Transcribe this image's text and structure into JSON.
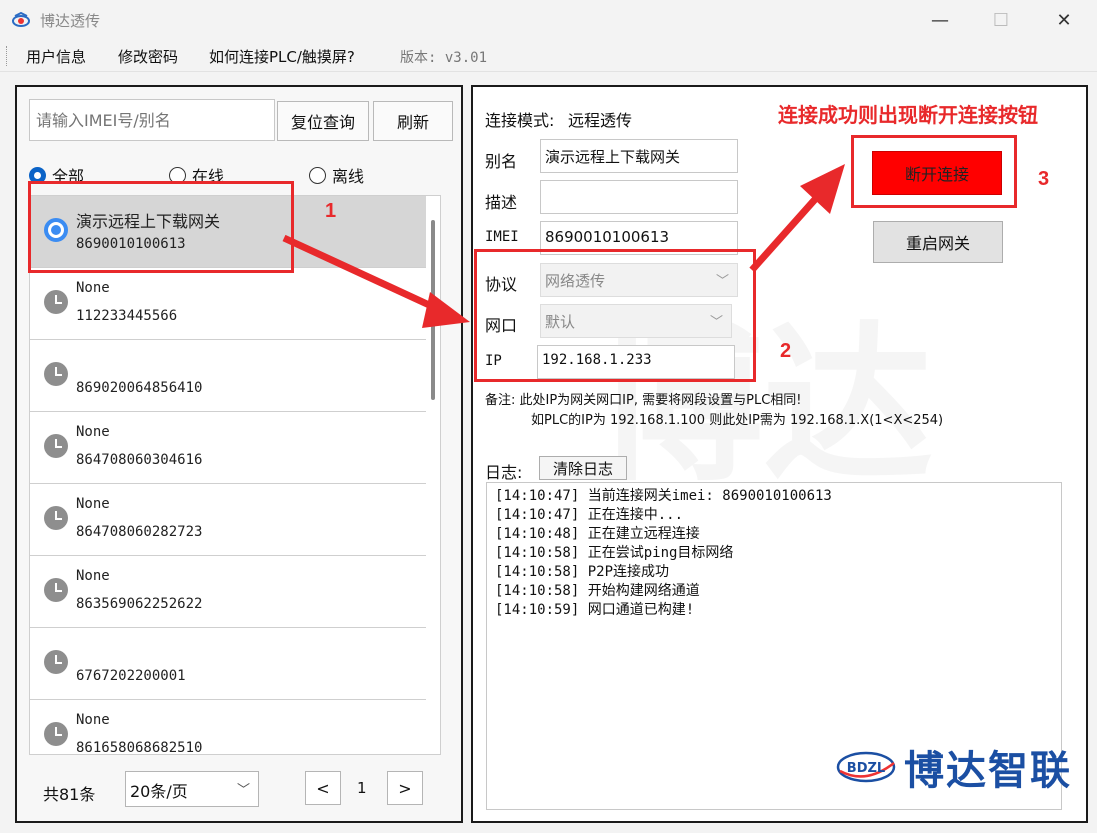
{
  "window": {
    "title": "博达透传",
    "minimize": "—",
    "maximize": "☐",
    "close": "✕"
  },
  "menu": {
    "items": [
      "用户信息",
      "修改密码",
      "如何连接PLC/触摸屏?"
    ],
    "version": "版本: v3.01"
  },
  "left": {
    "search_placeholder": "请输入IMEI号/别名",
    "reset_label": "复位查询",
    "refresh_label": "刷新",
    "filters": [
      {
        "label": "全部",
        "checked": true
      },
      {
        "label": "在线",
        "checked": false
      },
      {
        "label": "离线",
        "checked": false
      }
    ],
    "devices": [
      {
        "name": "演示远程上下载网关",
        "imei": "8690010100613",
        "status": "online",
        "selected": true
      },
      {
        "name": "None",
        "imei": "112233445566",
        "status": "offline"
      },
      {
        "name": "",
        "imei": "869020064856410",
        "status": "offline"
      },
      {
        "name": "None",
        "imei": "864708060304616",
        "status": "offline"
      },
      {
        "name": "None",
        "imei": "864708060282723",
        "status": "offline"
      },
      {
        "name": "None",
        "imei": "863569062252622",
        "status": "offline"
      },
      {
        "name": "",
        "imei": "6767202200001",
        "status": "offline"
      },
      {
        "name": "None",
        "imei": "861658068682510",
        "status": "offline"
      }
    ],
    "total": "共81条",
    "page_size": "20条/页",
    "page_prev": "<",
    "page_current": "1",
    "page_next": ">"
  },
  "right": {
    "mode_label": "连接模式:",
    "mode_value": "远程透传",
    "alias_label": "别名",
    "alias_value": "演示远程上下载网关",
    "desc_label": "描述",
    "desc_value": "",
    "imei_label": "IMEI",
    "imei_value": "8690010100613",
    "protocol_label": "协议",
    "protocol_value": "网络透传",
    "port_label": "网口",
    "port_value": "默认",
    "ip_label": "IP",
    "ip_value": "192.168.1.233",
    "disconnect_label": "断开连接",
    "restart_label": "重启网关",
    "note_line1": "备注: 此处IP为网关网口IP, 需要将网段设置与PLC相同!",
    "note_line2": "如PLC的IP为 192.168.1.100 则此处IP需为 192.168.1.X(1<X<254)",
    "log_label": "日志:",
    "clear_log_label": "清除日志",
    "logs": [
      "[14:10:47] 当前连接网关imei: 8690010100613",
      "[14:10:47] 正在连接中...",
      "[14:10:48] 正在建立远程连接",
      "[14:10:58] 正在尝试ping目标网络",
      "[14:10:58] P2P连接成功",
      "[14:10:58] 开始构建网络通道",
      "[14:10:59] 网口通道已构建!"
    ]
  },
  "watermark": "博达智联",
  "logo": {
    "badge": "BDZL",
    "text": "博达智联"
  },
  "annotations": {
    "n1": "1",
    "n2": "2",
    "n3": "3",
    "caption": "连接成功则出现断开连接按钮",
    "color": "#e8292b"
  }
}
